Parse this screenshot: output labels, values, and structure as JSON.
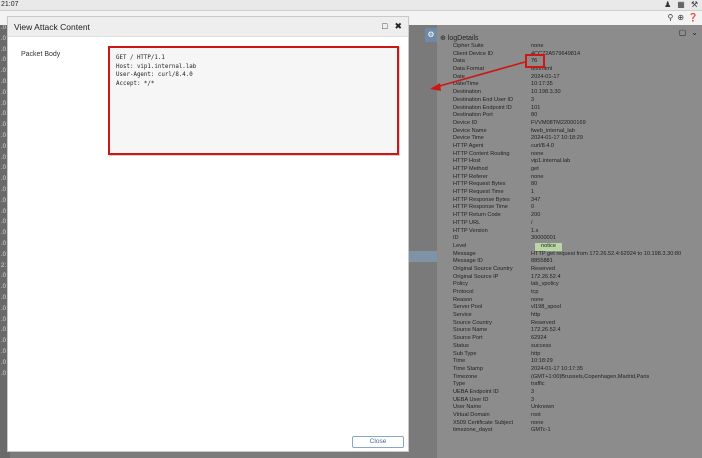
{
  "topbar": {
    "time": "21:07"
  },
  "left_stub_rows": [
    ".0",
    ".0",
    ".0",
    ".0",
    ".0",
    ".0",
    ".0",
    ".0",
    ".0",
    ".0",
    ".0",
    ".0",
    ".0",
    ".0",
    ".0",
    ".0",
    ".0",
    ".0",
    ".0",
    ".0",
    ".0",
    ".0",
    "2:",
    ".0",
    ".0",
    ".0",
    ".0",
    ".0",
    ".0",
    ".0",
    ".0",
    ".0",
    ".0"
  ],
  "log_details": {
    "header": "logDetails",
    "rows": [
      {
        "k": "Cipher Suite",
        "v": "none"
      },
      {
        "k": "Client Device ID",
        "v": "4CC72A579649814"
      },
      {
        "k": "Data",
        "v": "76"
      },
      {
        "k": "Data Format",
        "v": "text/html"
      },
      {
        "k": "Date",
        "v": "2024-01-17"
      },
      {
        "k": "Date/Time",
        "v": "10:17:35"
      },
      {
        "k": "Destination",
        "v": "10.198.3.30"
      },
      {
        "k": "Destination End User ID",
        "v": "3"
      },
      {
        "k": "Destination Endpoint ID",
        "v": "101"
      },
      {
        "k": "Destination Port",
        "v": "80"
      },
      {
        "k": "Device ID",
        "v": "FVVM08TM22000169"
      },
      {
        "k": "Device Name",
        "v": "fweb_internal_lab"
      },
      {
        "k": "Device Time",
        "v": "2024-01-17 10:18:29"
      },
      {
        "k": "HTTP Agent",
        "v": "curl/8.4.0"
      },
      {
        "k": "HTTP Content Routing",
        "v": "none"
      },
      {
        "k": "HTTP Host",
        "v": "vip1.internal.lab"
      },
      {
        "k": "HTTP Method",
        "v": "get"
      },
      {
        "k": "HTTP Referer",
        "v": "none"
      },
      {
        "k": "HTTP Request Bytes",
        "v": "80"
      },
      {
        "k": "HTTP Request Time",
        "v": "1"
      },
      {
        "k": "HTTP Response Bytes",
        "v": "347"
      },
      {
        "k": "HTTP Response Time",
        "v": "0"
      },
      {
        "k": "HTTP Return Code",
        "v": "200"
      },
      {
        "k": "HTTP URL",
        "v": "/"
      },
      {
        "k": "HTTP Version",
        "v": "1.x"
      },
      {
        "k": "ID",
        "v": "30000001"
      },
      {
        "k": "Level",
        "v": "notice",
        "badge": true
      },
      {
        "k": "Message",
        "v": "HTTP get request from 172.26.52.4:62924 to 10.198.3.30:80"
      },
      {
        "k": "Message ID",
        "v": "8855881"
      },
      {
        "k": "Original Source Country",
        "v": "Reserved"
      },
      {
        "k": "Original Source IP",
        "v": "172.26.52.4"
      },
      {
        "k": "Policy",
        "v": "lab_vpolicy"
      },
      {
        "k": "Protocol",
        "v": "tcp"
      },
      {
        "k": "Reason",
        "v": "none"
      },
      {
        "k": "Server Pool",
        "v": "vl198_spool"
      },
      {
        "k": "Service",
        "v": "http"
      },
      {
        "k": "Source Country",
        "v": "Reserved"
      },
      {
        "k": "Source Name",
        "v": "172.26.52.4"
      },
      {
        "k": "Source Port",
        "v": "62924"
      },
      {
        "k": "Status",
        "v": "success"
      },
      {
        "k": "Sub Type",
        "v": "http"
      },
      {
        "k": "Time",
        "v": "10:18:29"
      },
      {
        "k": "Time Stamp",
        "v": "2024-01-17 10:17:35"
      },
      {
        "k": "Timezone",
        "v": "(GMT+1:00)Brussels,Copenhagen,Madrid,Paris"
      },
      {
        "k": "Type",
        "v": "traffic"
      },
      {
        "k": "UEBA Endpoint ID",
        "v": "3"
      },
      {
        "k": "UEBA User ID",
        "v": "3"
      },
      {
        "k": "User Name",
        "v": "Unknown"
      },
      {
        "k": "Virtual Domain",
        "v": "root"
      },
      {
        "k": "X509 Certificate Subject",
        "v": "none"
      },
      {
        "k": "timezone_dayst",
        "v": "GMTc-1"
      }
    ]
  },
  "modal": {
    "title": "View Attack Content",
    "packet_label": "Packet Body",
    "packet_body": "GET / HTTP/1.1\nHost: vip1.internal.lab\nUser-Agent: curl/8.4.0\nAccept: */*",
    "close_label": "Close"
  },
  "colors": {
    "highlight_red": "#d01515",
    "level_badge": "#b9d6a5",
    "close_blue": "#3a6aa6"
  }
}
